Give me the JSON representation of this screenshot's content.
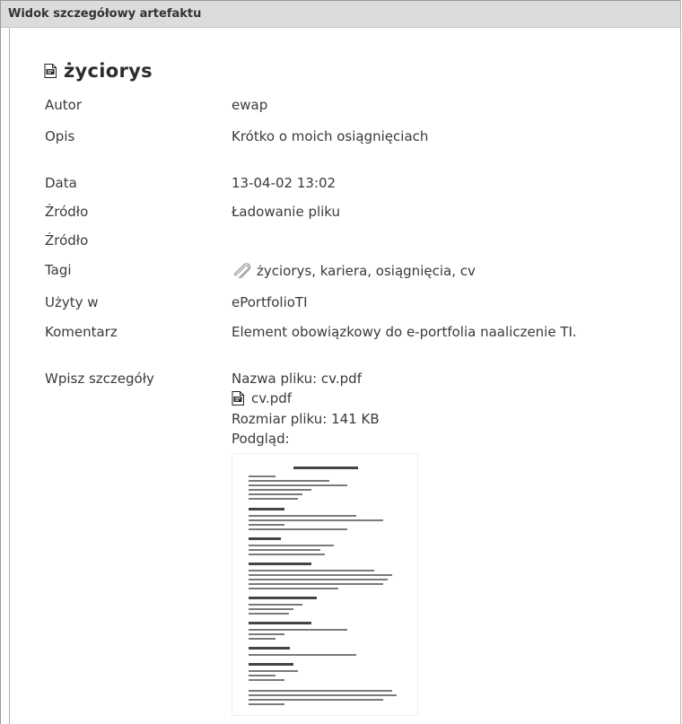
{
  "panel": {
    "header": "Widok szczegółowy artefaktu"
  },
  "artefact": {
    "title": "życiorys",
    "icon": "pdf-file-icon"
  },
  "fields": {
    "author_label": "Autor",
    "author_value": "ewap",
    "desc_label": "Opis",
    "desc_value": "Krótko o moich osiągnięciach",
    "date_label": "Data",
    "date_value": "13-04-02 13:02",
    "source1_label": "Źródło",
    "source1_value": "Ładowanie pliku",
    "source2_label": "Źródło",
    "tags_label": "Tagi",
    "tags_value": "życiorys, kariera, osiągnięcia, cv",
    "tags_icon": "tag-icon",
    "used_label": "Użyty w",
    "used_value": "ePortfolioTI",
    "comment_label": "Komentarz",
    "comment_value": "Element obowiązkowy do e-portfolia naaliczenie TI.",
    "details_label": "Wpisz szczegóły"
  },
  "details": {
    "filename": "Nazwa pliku: cv.pdf",
    "file_link": "cv.pdf",
    "filesize": "Rozmiar pliku: 141 KB",
    "preview_label": "Podgląd:"
  }
}
